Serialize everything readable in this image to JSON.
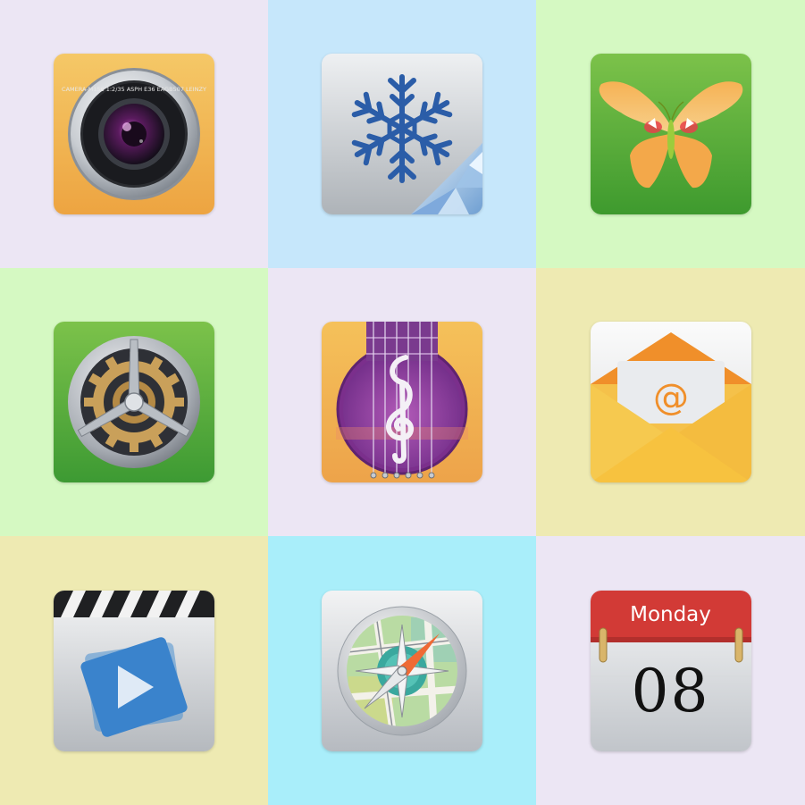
{
  "colors": {
    "lavender": "#ece6f4",
    "sky": "#c6e7fb",
    "mint": "#d5f9c2",
    "pale_yellow": "#eeeab2",
    "aqua": "#a9eefa",
    "calendar_red": "#d23a36"
  },
  "icons": [
    {
      "name": "camera-lens-icon"
    },
    {
      "name": "snowflake-icon"
    },
    {
      "name": "butterfly-icon"
    },
    {
      "name": "gear-settings-icon"
    },
    {
      "name": "guitar-music-icon"
    },
    {
      "name": "mail-envelope-icon"
    },
    {
      "name": "video-clapper-icon"
    },
    {
      "name": "compass-map-icon"
    },
    {
      "name": "calendar-icon"
    }
  ],
  "camera": {
    "lens_text": "CAMERA-M156  1:2/35  ASPH  E36  EAGB507  LEINZY"
  },
  "mail": {
    "at_symbol": "@"
  },
  "calendar": {
    "day": "Monday",
    "date": "08"
  }
}
